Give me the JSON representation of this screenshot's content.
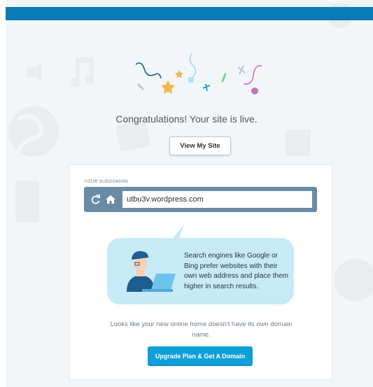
{
  "congrats_text": "Congratulations! Your site is live.",
  "view_site_label": "View My Site",
  "subdomain_label": "YOUR SUBDOMAIN",
  "subdomain_value": "utbu3v.wordpress.com",
  "bubble_text": "Search engines like Google or Bing prefer websites with their own web address and place them higher in search results.",
  "note_text": "Looks like your new online home doesn't have its own domain name.",
  "upgrade_label": "Upgrade Plan & Get A Domain",
  "icons": [
    "refresh-icon",
    "home-icon",
    "confetti-illustration",
    "person-laptop-illustration"
  ],
  "colors": {
    "topbar": "#0a7bb6",
    "accent": "#109fd8",
    "bubble": "#c6ebf7",
    "browser": "#698ba6"
  }
}
